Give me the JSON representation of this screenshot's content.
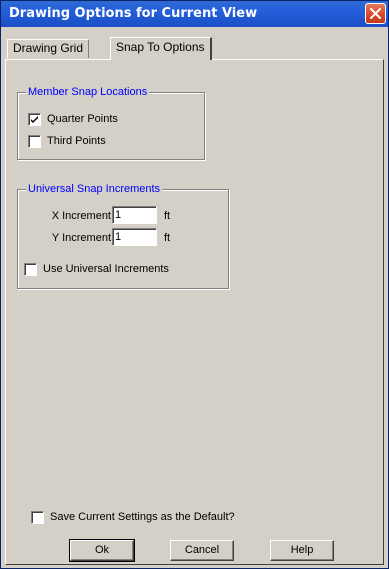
{
  "window": {
    "title": "Drawing Options for Current View"
  },
  "tabs": [
    {
      "label": "Drawing Grid",
      "active": false
    },
    {
      "label": "Snap To Options",
      "active": true
    }
  ],
  "member_snap": {
    "legend": "Member Snap Locations",
    "quarter_points": {
      "label": "Quarter Points",
      "checked": true
    },
    "third_points": {
      "label": "Third Points",
      "checked": false
    }
  },
  "universal_snap": {
    "legend": "Universal Snap Increments",
    "x_increment": {
      "label": "X Increment",
      "value": "1",
      "unit": "ft"
    },
    "y_increment": {
      "label": "Y Increment",
      "value": "1",
      "unit": "ft"
    },
    "use_universal": {
      "label": "Use Universal Increments",
      "checked": false
    }
  },
  "save_default": {
    "label": "Save Current Settings as the Default?",
    "checked": false
  },
  "buttons": {
    "ok": "Ok",
    "cancel": "Cancel",
    "help": "Help"
  },
  "icons": {
    "close": "close-icon",
    "check": "checkmark-icon"
  }
}
